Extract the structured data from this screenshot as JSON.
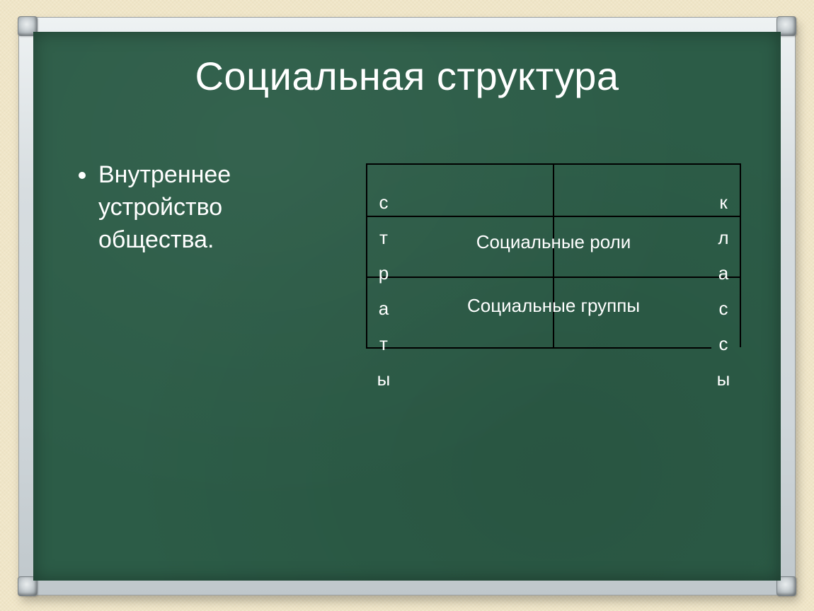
{
  "slide": {
    "title": "Социальная структура",
    "bullet": "Внутреннее устройство общества."
  },
  "table": {
    "left_vertical_word": "страты",
    "right_vertical_word": "классы",
    "row1_label": "Социальные роли",
    "row2_label": "Социальные группы"
  }
}
